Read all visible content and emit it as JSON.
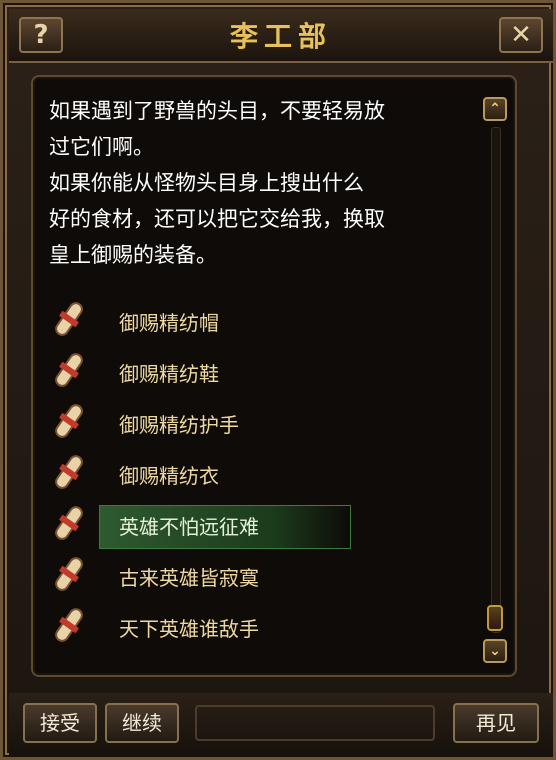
{
  "window": {
    "title": "李工部",
    "help_label": "?",
    "close_label": "✕"
  },
  "dialog": {
    "text": "如果遇到了野兽的头目，不要轻易放\n过它们啊。\n  如果你能从怪物头目身上搜出什么\n好的食材，还可以把它交给我，换取\n皇上御赐的装备。"
  },
  "quests": [
    {
      "label": "御赐精纺帽",
      "icon": "scroll-icon"
    },
    {
      "label": "御赐精纺鞋",
      "icon": "scroll-icon"
    },
    {
      "label": "御赐精纺护手",
      "icon": "scroll-icon"
    },
    {
      "label": "御赐精纺衣",
      "icon": "scroll-icon"
    },
    {
      "label": "英雄不怕远征难",
      "icon": "scroll-icon",
      "selected": true
    },
    {
      "label": "古来英雄皆寂寞",
      "icon": "scroll-icon"
    },
    {
      "label": "天下英雄谁敌手",
      "icon": "scroll-icon"
    }
  ],
  "footer": {
    "accept_label": "接受",
    "continue_label": "继续",
    "goodbye_label": "再见"
  },
  "colors": {
    "title": "#e7c25c",
    "quest_text": "#f0d9a0",
    "selected_bg": "#2f5a2f"
  }
}
